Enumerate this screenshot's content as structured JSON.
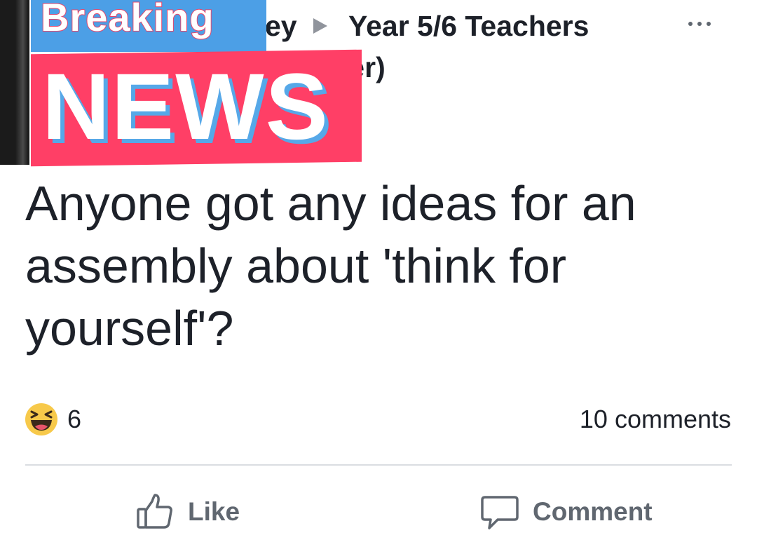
{
  "header": {
    "author_visible_fragment": "ey",
    "author_line2_fragment": "tter)",
    "group_name": "Year 5/6 Teachers",
    "more_icon": "more-horizontal-icon"
  },
  "overlay": {
    "breaking": "Breaking",
    "news": "NEWS",
    "colors": {
      "breaking_bg": "#4c9fe6",
      "news_bg": "#ff3f66"
    }
  },
  "post": {
    "text": "Anyone got any ideas for an assembly about 'think for yourself'?"
  },
  "reactions": {
    "icon": "haha-reaction-icon",
    "count": "6",
    "comments": "10 comments"
  },
  "actions": {
    "like_label": "Like",
    "comment_label": "Comment"
  },
  "colors": {
    "text_primary": "#1d2129",
    "text_secondary": "#606770",
    "divider": "#dadde1",
    "haha_yellow": "#f7c94a"
  }
}
